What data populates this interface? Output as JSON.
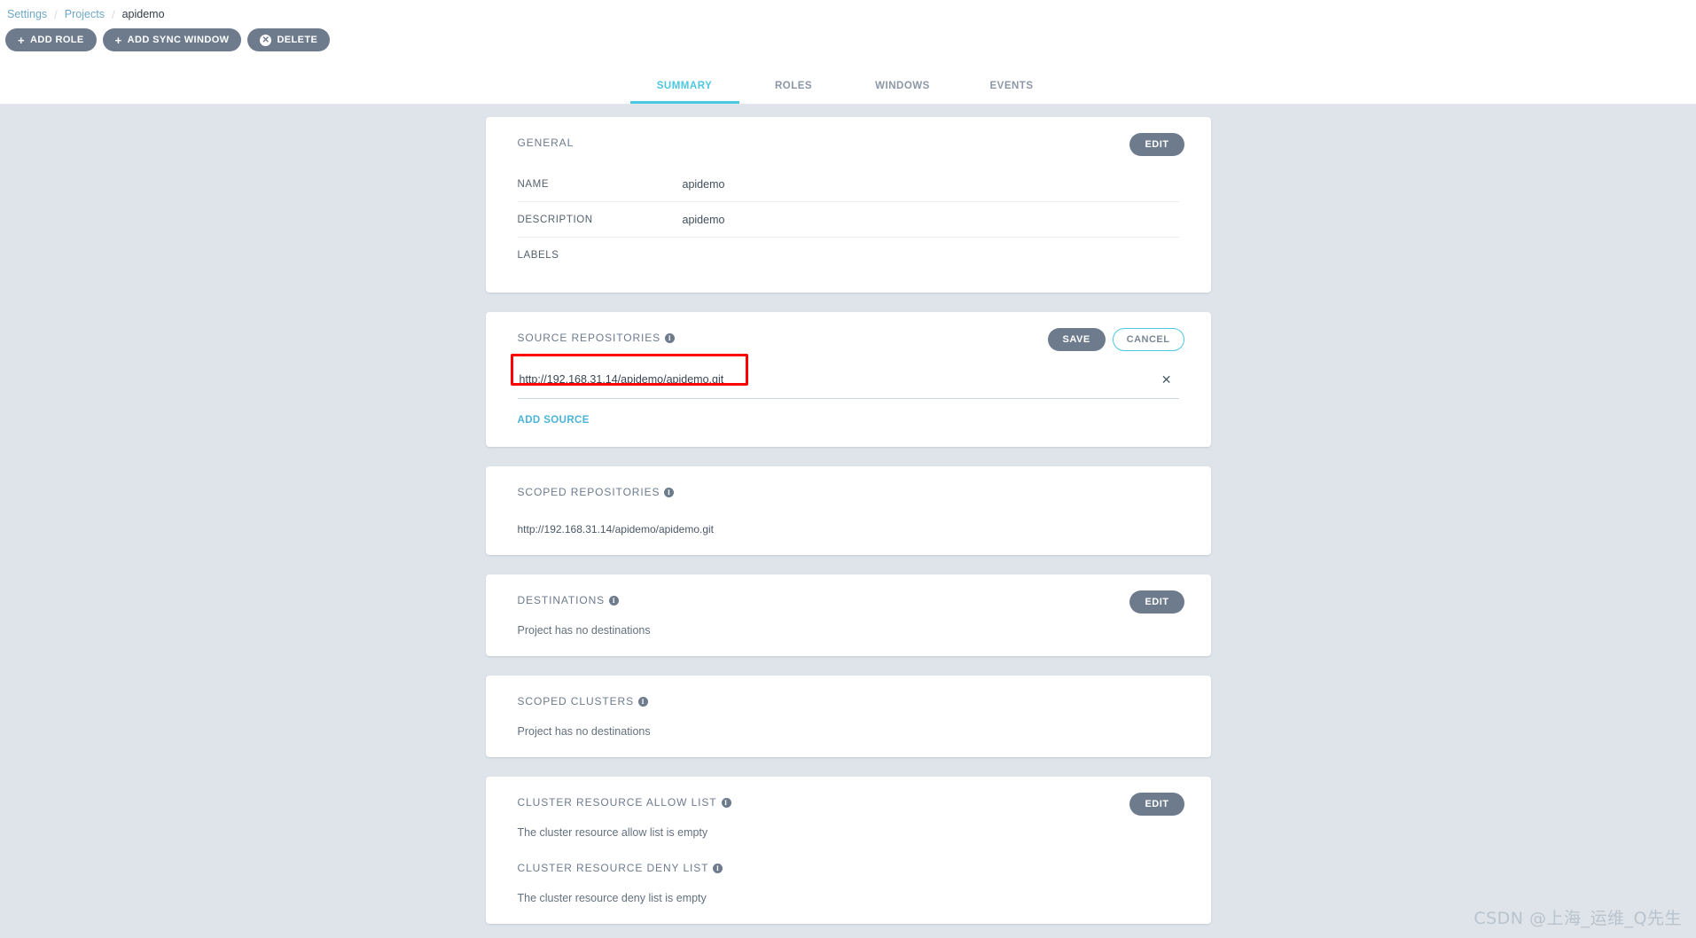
{
  "breadcrumb": {
    "items": [
      {
        "label": "Settings",
        "link": true
      },
      {
        "label": "Projects",
        "link": true
      },
      {
        "label": "apidemo",
        "link": false
      }
    ],
    "separator": "/"
  },
  "toolbar": {
    "add_role_label": "ADD ROLE",
    "add_sync_window_label": "ADD SYNC WINDOW",
    "delete_label": "DELETE",
    "plus_glyph": "+",
    "delete_glyph": "✕"
  },
  "tabs": [
    {
      "label": "SUMMARY",
      "active": true
    },
    {
      "label": "ROLES",
      "active": false
    },
    {
      "label": "WINDOWS",
      "active": false
    },
    {
      "label": "EVENTS",
      "active": false
    }
  ],
  "accent_color": "#4cc7e0",
  "muted_color": "#6d7b8d",
  "annotation_color": "#fe0000",
  "cards": {
    "general": {
      "title": "GENERAL",
      "edit_label": "EDIT",
      "rows": [
        {
          "key": "NAME",
          "value": "apidemo"
        },
        {
          "key": "DESCRIPTION",
          "value": "apidemo"
        },
        {
          "key": "LABELS",
          "value": ""
        }
      ]
    },
    "source_repositories": {
      "title": "SOURCE REPOSITORIES",
      "info_glyph": "i",
      "save_label": "SAVE",
      "cancel_label": "CANCEL",
      "input_value": "http://192.168.31.14/apidemo/apidemo.git",
      "input_placeholder": "",
      "remove_glyph": "✕",
      "add_source_label": "ADD SOURCE"
    },
    "scoped_repositories": {
      "title": "SCOPED REPOSITORIES",
      "info_glyph": "i",
      "value": "http://192.168.31.14/apidemo/apidemo.git"
    },
    "destinations": {
      "title": "DESTINATIONS",
      "info_glyph": "i",
      "edit_label": "EDIT",
      "empty_text": "Project has no destinations"
    },
    "scoped_clusters": {
      "title": "SCOPED CLUSTERS",
      "info_glyph": "i",
      "empty_text": "Project has no destinations"
    },
    "cluster_resources": {
      "allow_title": "CLUSTER RESOURCE ALLOW LIST",
      "allow_info_glyph": "i",
      "allow_empty_text": "The cluster resource allow list is empty",
      "deny_title": "CLUSTER RESOURCE DENY LIST",
      "deny_info_glyph": "i",
      "deny_empty_text": "The cluster resource deny list is empty",
      "edit_label": "EDIT"
    }
  },
  "watermark": "CSDN @上海_运维_Q先生"
}
